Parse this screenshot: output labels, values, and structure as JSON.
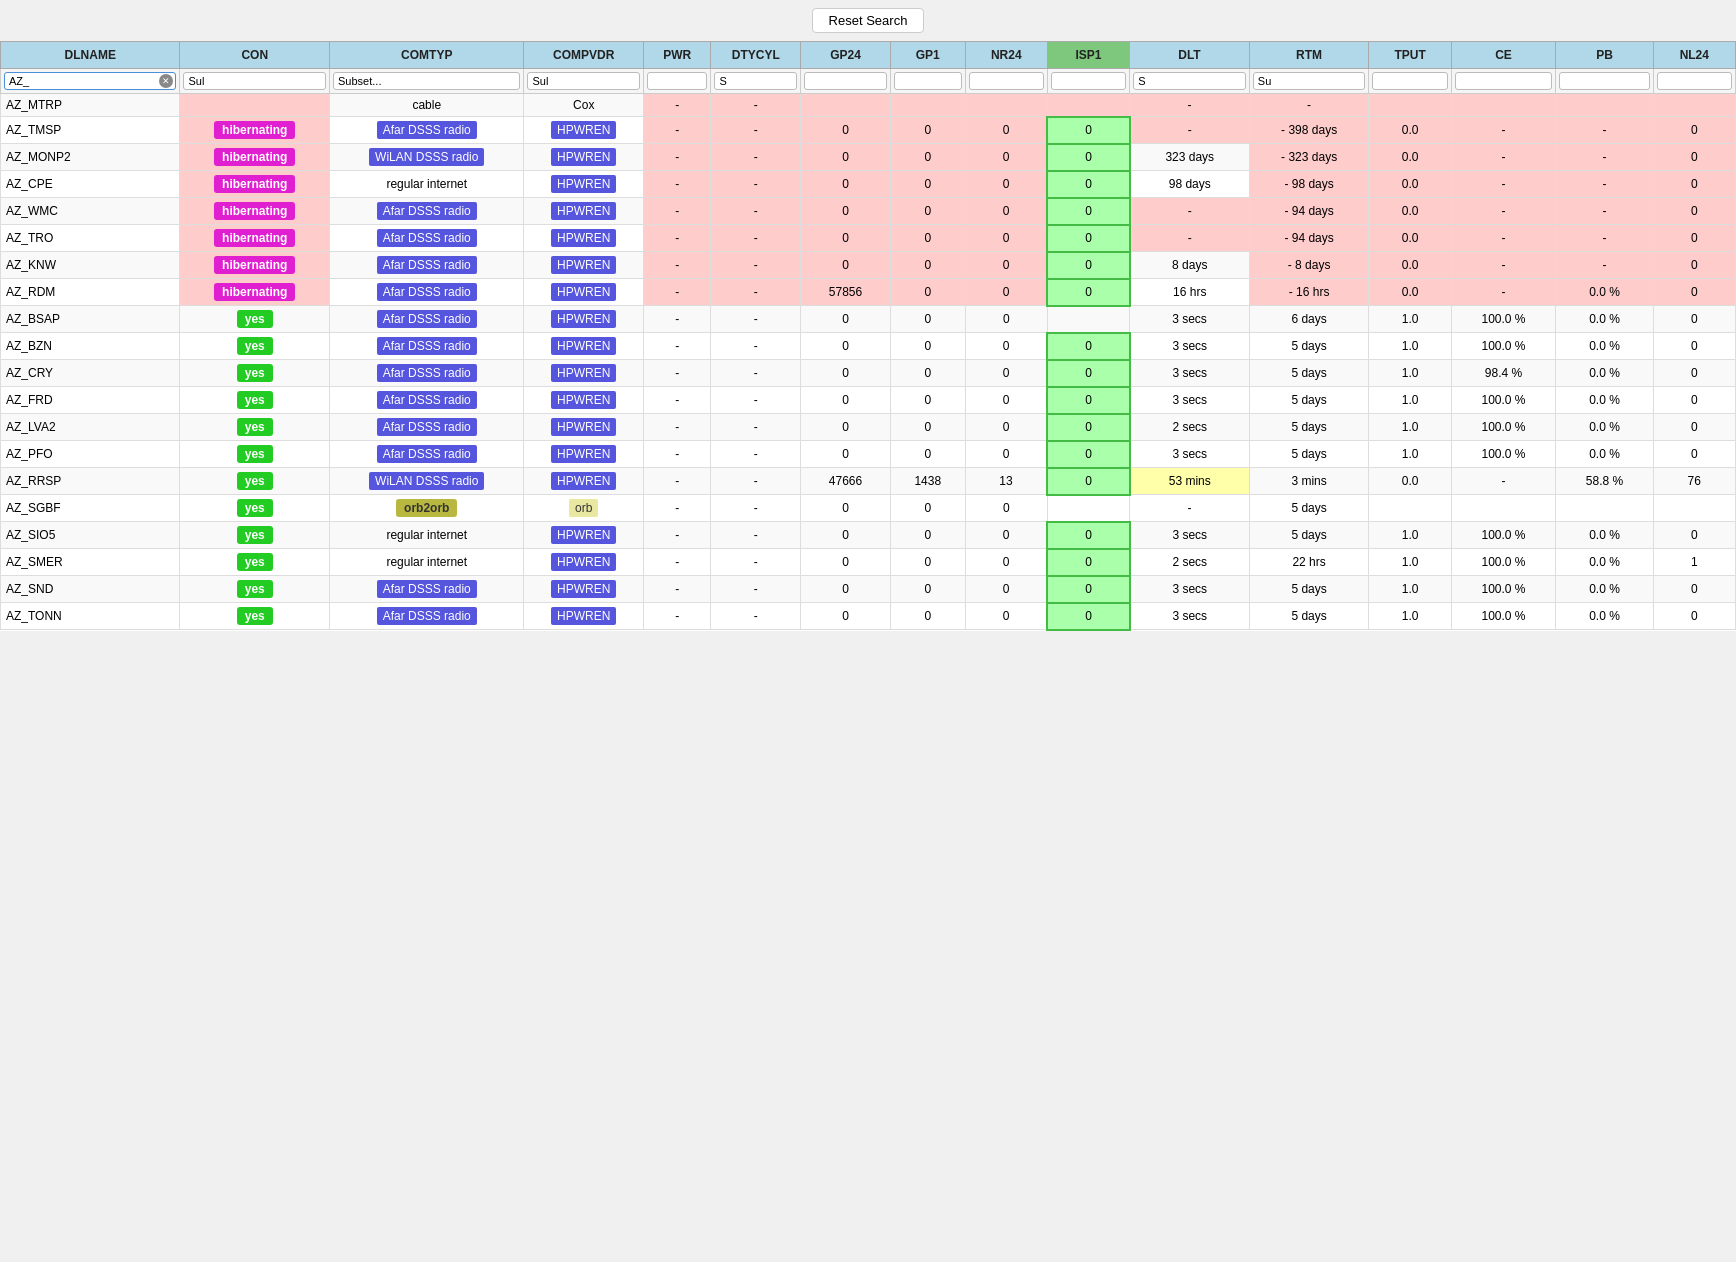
{
  "toolbar": {
    "reset_search_label": "Reset Search"
  },
  "columns": [
    {
      "key": "dlname",
      "label": "DLNAME"
    },
    {
      "key": "con",
      "label": "CON"
    },
    {
      "key": "comtyp",
      "label": "COMTYP"
    },
    {
      "key": "compvdr",
      "label": "COMPVDR"
    },
    {
      "key": "pwr",
      "label": "PWR"
    },
    {
      "key": "dtycyl",
      "label": "DTYCYL"
    },
    {
      "key": "gp24",
      "label": "GP24"
    },
    {
      "key": "gp1",
      "label": "GP1"
    },
    {
      "key": "nr24",
      "label": "NR24"
    },
    {
      "key": "isp1",
      "label": "ISP1"
    },
    {
      "key": "dlt",
      "label": "DLT"
    },
    {
      "key": "rtm",
      "label": "RTM"
    },
    {
      "key": "tput",
      "label": "TPUT"
    },
    {
      "key": "ce",
      "label": "CE"
    },
    {
      "key": "pb",
      "label": "PB"
    },
    {
      "key": "nl24",
      "label": "NL24"
    }
  ],
  "filters": {
    "dlname": "AZ_",
    "con": "Sul",
    "comtyp": "Subset...",
    "compvdr": "Sul",
    "pwr": "",
    "dtycyl": "S",
    "gp24": "",
    "gp1": "",
    "nr24": "",
    "isp1": "",
    "dlt": "S",
    "rtm": "Su",
    "tput": "",
    "ce": "",
    "pb": "",
    "nl24": ""
  },
  "rows": [
    {
      "dlname": "AZ_MTRP",
      "con": "",
      "con_type": "none",
      "comtyp": "cable",
      "comtyp_type": "plain",
      "compvdr": "Cox",
      "compvdr_type": "plain",
      "pwr": "-",
      "dtycyl": "-",
      "gp24": "",
      "gp1": "",
      "nr24": "",
      "isp1": "",
      "dlt": "-",
      "rtm": "-",
      "tput": "",
      "ce": "",
      "pb": "",
      "nl24": "",
      "row_bg": "pink"
    },
    {
      "dlname": "AZ_TMSP",
      "con": "hibernating",
      "con_type": "hibernating",
      "comtyp": "Afar DSSS radio",
      "comtyp_type": "radio",
      "compvdr": "HPWREN",
      "compvdr_type": "hpwren",
      "pwr": "-",
      "dtycyl": "-",
      "gp24": "0",
      "gp1": "0",
      "nr24": "0",
      "isp1": "0",
      "dlt": "-",
      "rtm": "- 398 days",
      "tput": "0.0",
      "ce": "-",
      "pb": "-",
      "nl24": "0",
      "row_bg": "pink",
      "isp1_green": true
    },
    {
      "dlname": "AZ_MONP2",
      "con": "hibernating",
      "con_type": "hibernating",
      "comtyp": "WiLAN DSSS radio",
      "comtyp_type": "radio",
      "compvdr": "HPWREN",
      "compvdr_type": "hpwren",
      "pwr": "-",
      "dtycyl": "-",
      "gp24": "0",
      "gp1": "0",
      "nr24": "0",
      "isp1": "0",
      "dlt": "323 days",
      "rtm": "- 323 days",
      "tput": "0.0",
      "ce": "-",
      "pb": "-",
      "nl24": "0",
      "row_bg": "pink",
      "isp1_green": true
    },
    {
      "dlname": "AZ_CPE",
      "con": "hibernating",
      "con_type": "hibernating",
      "comtyp": "regular internet",
      "comtyp_type": "plain",
      "compvdr": "HPWREN",
      "compvdr_type": "hpwren",
      "pwr": "-",
      "dtycyl": "-",
      "gp24": "0",
      "gp1": "0",
      "nr24": "0",
      "isp1": "0",
      "dlt": "98 days",
      "rtm": "- 98 days",
      "tput": "0.0",
      "ce": "-",
      "pb": "-",
      "nl24": "0",
      "row_bg": "pink",
      "isp1_green": true
    },
    {
      "dlname": "AZ_WMC",
      "con": "hibernating",
      "con_type": "hibernating",
      "comtyp": "Afar DSSS radio",
      "comtyp_type": "radio",
      "compvdr": "HPWREN",
      "compvdr_type": "hpwren",
      "pwr": "-",
      "dtycyl": "-",
      "gp24": "0",
      "gp1": "0",
      "nr24": "0",
      "isp1": "0",
      "dlt": "-",
      "rtm": "- 94 days",
      "tput": "0.0",
      "ce": "-",
      "pb": "-",
      "nl24": "0",
      "row_bg": "pink",
      "isp1_green": true
    },
    {
      "dlname": "AZ_TRO",
      "con": "hibernating",
      "con_type": "hibernating",
      "comtyp": "Afar DSSS radio",
      "comtyp_type": "radio",
      "compvdr": "HPWREN",
      "compvdr_type": "hpwren",
      "pwr": "-",
      "dtycyl": "-",
      "gp24": "0",
      "gp1": "0",
      "nr24": "0",
      "isp1": "0",
      "dlt": "-",
      "rtm": "- 94 days",
      "tput": "0.0",
      "ce": "-",
      "pb": "-",
      "nl24": "0",
      "row_bg": "pink",
      "isp1_green": true
    },
    {
      "dlname": "AZ_KNW",
      "con": "hibernating",
      "con_type": "hibernating",
      "comtyp": "Afar DSSS radio",
      "comtyp_type": "radio",
      "compvdr": "HPWREN",
      "compvdr_type": "hpwren",
      "pwr": "-",
      "dtycyl": "-",
      "gp24": "0",
      "gp1": "0",
      "nr24": "0",
      "isp1": "0",
      "dlt": "8 days",
      "rtm": "- 8 days",
      "tput": "0.0",
      "ce": "-",
      "pb": "-",
      "nl24": "0",
      "row_bg": "pink",
      "isp1_green": true
    },
    {
      "dlname": "AZ_RDM",
      "con": "hibernating",
      "con_type": "hibernating",
      "comtyp": "Afar DSSS radio",
      "comtyp_type": "radio",
      "compvdr": "HPWREN",
      "compvdr_type": "hpwren",
      "pwr": "-",
      "dtycyl": "-",
      "gp24": "57856",
      "gp1": "0",
      "nr24": "0",
      "isp1": "0",
      "dlt": "16 hrs",
      "rtm": "- 16 hrs",
      "tput": "0.0",
      "ce": "-",
      "pb": "0.0 %",
      "nl24": "0",
      "row_bg": "pink",
      "isp1_green": true
    },
    {
      "dlname": "AZ_BSAP",
      "con": "yes",
      "con_type": "yes",
      "comtyp": "Afar DSSS radio",
      "comtyp_type": "radio",
      "compvdr": "HPWREN",
      "compvdr_type": "hpwren",
      "pwr": "-",
      "dtycyl": "-",
      "gp24": "0",
      "gp1": "0",
      "nr24": "0",
      "isp1": "",
      "dlt": "3 secs",
      "rtm": "6 days",
      "tput": "1.0",
      "ce": "100.0 %",
      "pb": "0.0 %",
      "nl24": "0",
      "row_bg": "normal",
      "isp1_green": false
    },
    {
      "dlname": "AZ_BZN",
      "con": "yes",
      "con_type": "yes",
      "comtyp": "Afar DSSS radio",
      "comtyp_type": "radio",
      "compvdr": "HPWREN",
      "compvdr_type": "hpwren",
      "pwr": "-",
      "dtycyl": "-",
      "gp24": "0",
      "gp1": "0",
      "nr24": "0",
      "isp1": "0",
      "dlt": "3 secs",
      "rtm": "5 days",
      "tput": "1.0",
      "ce": "100.0 %",
      "pb": "0.0 %",
      "nl24": "0",
      "row_bg": "normal",
      "isp1_green": true
    },
    {
      "dlname": "AZ_CRY",
      "con": "yes",
      "con_type": "yes",
      "comtyp": "Afar DSSS radio",
      "comtyp_type": "radio",
      "compvdr": "HPWREN",
      "compvdr_type": "hpwren",
      "pwr": "-",
      "dtycyl": "-",
      "gp24": "0",
      "gp1": "0",
      "nr24": "0",
      "isp1": "0",
      "dlt": "3 secs",
      "rtm": "5 days",
      "tput": "1.0",
      "ce": "98.4 %",
      "pb": "0.0 %",
      "nl24": "0",
      "row_bg": "normal",
      "isp1_green": true
    },
    {
      "dlname": "AZ_FRD",
      "con": "yes",
      "con_type": "yes",
      "comtyp": "Afar DSSS radio",
      "comtyp_type": "radio",
      "compvdr": "HPWREN",
      "compvdr_type": "hpwren",
      "pwr": "-",
      "dtycyl": "-",
      "gp24": "0",
      "gp1": "0",
      "nr24": "0",
      "isp1": "0",
      "dlt": "3 secs",
      "rtm": "5 days",
      "tput": "1.0",
      "ce": "100.0 %",
      "pb": "0.0 %",
      "nl24": "0",
      "row_bg": "normal",
      "isp1_green": true
    },
    {
      "dlname": "AZ_LVA2",
      "con": "yes",
      "con_type": "yes",
      "comtyp": "Afar DSSS radio",
      "comtyp_type": "radio",
      "compvdr": "HPWREN",
      "compvdr_type": "hpwren",
      "pwr": "-",
      "dtycyl": "-",
      "gp24": "0",
      "gp1": "0",
      "nr24": "0",
      "isp1": "0",
      "dlt": "2 secs",
      "rtm": "5 days",
      "tput": "1.0",
      "ce": "100.0 %",
      "pb": "0.0 %",
      "nl24": "0",
      "row_bg": "normal",
      "isp1_green": true
    },
    {
      "dlname": "AZ_PFO",
      "con": "yes",
      "con_type": "yes",
      "comtyp": "Afar DSSS radio",
      "comtyp_type": "radio",
      "compvdr": "HPWREN",
      "compvdr_type": "hpwren",
      "pwr": "-",
      "dtycyl": "-",
      "gp24": "0",
      "gp1": "0",
      "nr24": "0",
      "isp1": "0",
      "dlt": "3 secs",
      "rtm": "5 days",
      "tput": "1.0",
      "ce": "100.0 %",
      "pb": "0.0 %",
      "nl24": "0",
      "row_bg": "normal",
      "isp1_green": true
    },
    {
      "dlname": "AZ_RRSP",
      "con": "yes",
      "con_type": "yes",
      "comtyp": "WiLAN DSSS radio",
      "comtyp_type": "radio",
      "compvdr": "HPWREN",
      "compvdr_type": "hpwren",
      "pwr": "-",
      "dtycyl": "-",
      "gp24": "47666",
      "gp1": "1438",
      "nr24": "13",
      "isp1": "0",
      "dlt": "53 mins",
      "rtm": "3 mins",
      "tput": "0.0",
      "ce": "-",
      "pb": "58.8 %",
      "nl24": "76",
      "row_bg": "normal",
      "isp1_green": true,
      "dlt_yellow": true
    },
    {
      "dlname": "AZ_SGBF",
      "con": "yes",
      "con_type": "yes",
      "comtyp": "orb2orb",
      "comtyp_type": "orb2orb",
      "compvdr": "orb",
      "compvdr_type": "orb",
      "pwr": "-",
      "dtycyl": "-",
      "gp24": "0",
      "gp1": "0",
      "nr24": "0",
      "isp1": "",
      "dlt": "-",
      "rtm": "5 days",
      "tput": "",
      "ce": "",
      "pb": "",
      "nl24": "",
      "row_bg": "normal",
      "isp1_green": false
    },
    {
      "dlname": "AZ_SIO5",
      "con": "yes",
      "con_type": "yes",
      "comtyp": "regular internet",
      "comtyp_type": "plain",
      "compvdr": "HPWREN",
      "compvdr_type": "hpwren",
      "pwr": "-",
      "dtycyl": "-",
      "gp24": "0",
      "gp1": "0",
      "nr24": "0",
      "isp1": "0",
      "dlt": "3 secs",
      "rtm": "5 days",
      "tput": "1.0",
      "ce": "100.0 %",
      "pb": "0.0 %",
      "nl24": "0",
      "row_bg": "normal",
      "isp1_green": true
    },
    {
      "dlname": "AZ_SMER",
      "con": "yes",
      "con_type": "yes",
      "comtyp": "regular internet",
      "comtyp_type": "plain",
      "compvdr": "HPWREN",
      "compvdr_type": "hpwren",
      "pwr": "-",
      "dtycyl": "-",
      "gp24": "0",
      "gp1": "0",
      "nr24": "0",
      "isp1": "0",
      "dlt": "2 secs",
      "rtm": "22 hrs",
      "tput": "1.0",
      "ce": "100.0 %",
      "pb": "0.0 %",
      "nl24": "1",
      "row_bg": "normal",
      "isp1_green": true
    },
    {
      "dlname": "AZ_SND",
      "con": "yes",
      "con_type": "yes",
      "comtyp": "Afar DSSS radio",
      "comtyp_type": "radio",
      "compvdr": "HPWREN",
      "compvdr_type": "hpwren",
      "pwr": "-",
      "dtycyl": "-",
      "gp24": "0",
      "gp1": "0",
      "nr24": "0",
      "isp1": "0",
      "dlt": "3 secs",
      "rtm": "5 days",
      "tput": "1.0",
      "ce": "100.0 %",
      "pb": "0.0 %",
      "nl24": "0",
      "row_bg": "normal",
      "isp1_green": true
    },
    {
      "dlname": "AZ_TONN",
      "con": "yes",
      "con_type": "yes",
      "comtyp": "Afar DSSS radio",
      "comtyp_type": "radio",
      "compvdr": "HPWREN",
      "compvdr_type": "hpwren",
      "pwr": "-",
      "dtycyl": "-",
      "gp24": "0",
      "gp1": "0",
      "nr24": "0",
      "isp1": "0",
      "dlt": "3 secs",
      "rtm": "5 days",
      "tput": "1.0",
      "ce": "100.0 %",
      "pb": "0.0 %",
      "nl24": "0",
      "row_bg": "normal",
      "isp1_green": true
    }
  ]
}
